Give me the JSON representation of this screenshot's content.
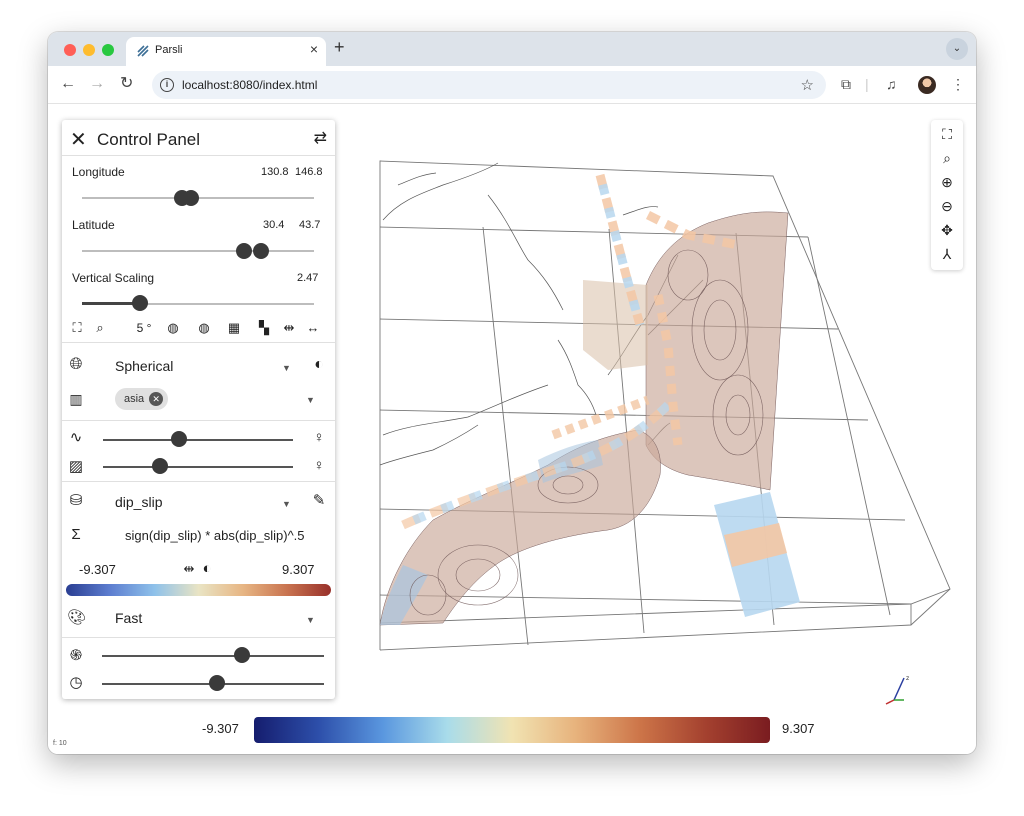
{
  "browser": {
    "tab_title": "Parsli",
    "tab_close": "×",
    "new_tab": "+",
    "url": "localhost:8080/index.html",
    "icons": [
      "back-icon",
      "forward-icon",
      "reload-icon",
      "info-icon",
      "star-icon",
      "extensions-icon",
      "media-icon",
      "avatar",
      "more-icon"
    ]
  },
  "panel": {
    "title": "Control Panel",
    "longitude": {
      "label": "Longitude",
      "min": "130.8",
      "max": "146.8",
      "fraction": [
        0.43,
        0.47
      ]
    },
    "latitude": {
      "label": "Latitude",
      "min": "30.4",
      "max": "43.7",
      "fraction": [
        0.7,
        0.77
      ]
    },
    "vertical_scaling": {
      "label": "Vertical Scaling",
      "value": "2.47",
      "fraction": 0.25
    },
    "grid_step": "5 °",
    "projection": "Spherical",
    "basemap_chip": "asia",
    "line_opacity": 0.4,
    "surface_opacity": 0.3,
    "field": "dip_slip",
    "formula": "sign(dip_slip) * abs(dip_slip)^.5",
    "range_min": "-9.307",
    "range_max": "9.307",
    "colormap": "Fast",
    "quality_level": 0.63,
    "time_level": 0.52
  },
  "colorbar": {
    "min": "-9.307",
    "max": "9.307"
  },
  "fps": "f: 10",
  "colors": {
    "accent": "#3a3a3a",
    "window_chrome": "#dde3ea",
    "surface_warm": "#c9a898",
    "surface_cool": "#a8c4df",
    "stripe_orange": "#f3c7a4",
    "stripe_blue": "#b7d7ef"
  }
}
